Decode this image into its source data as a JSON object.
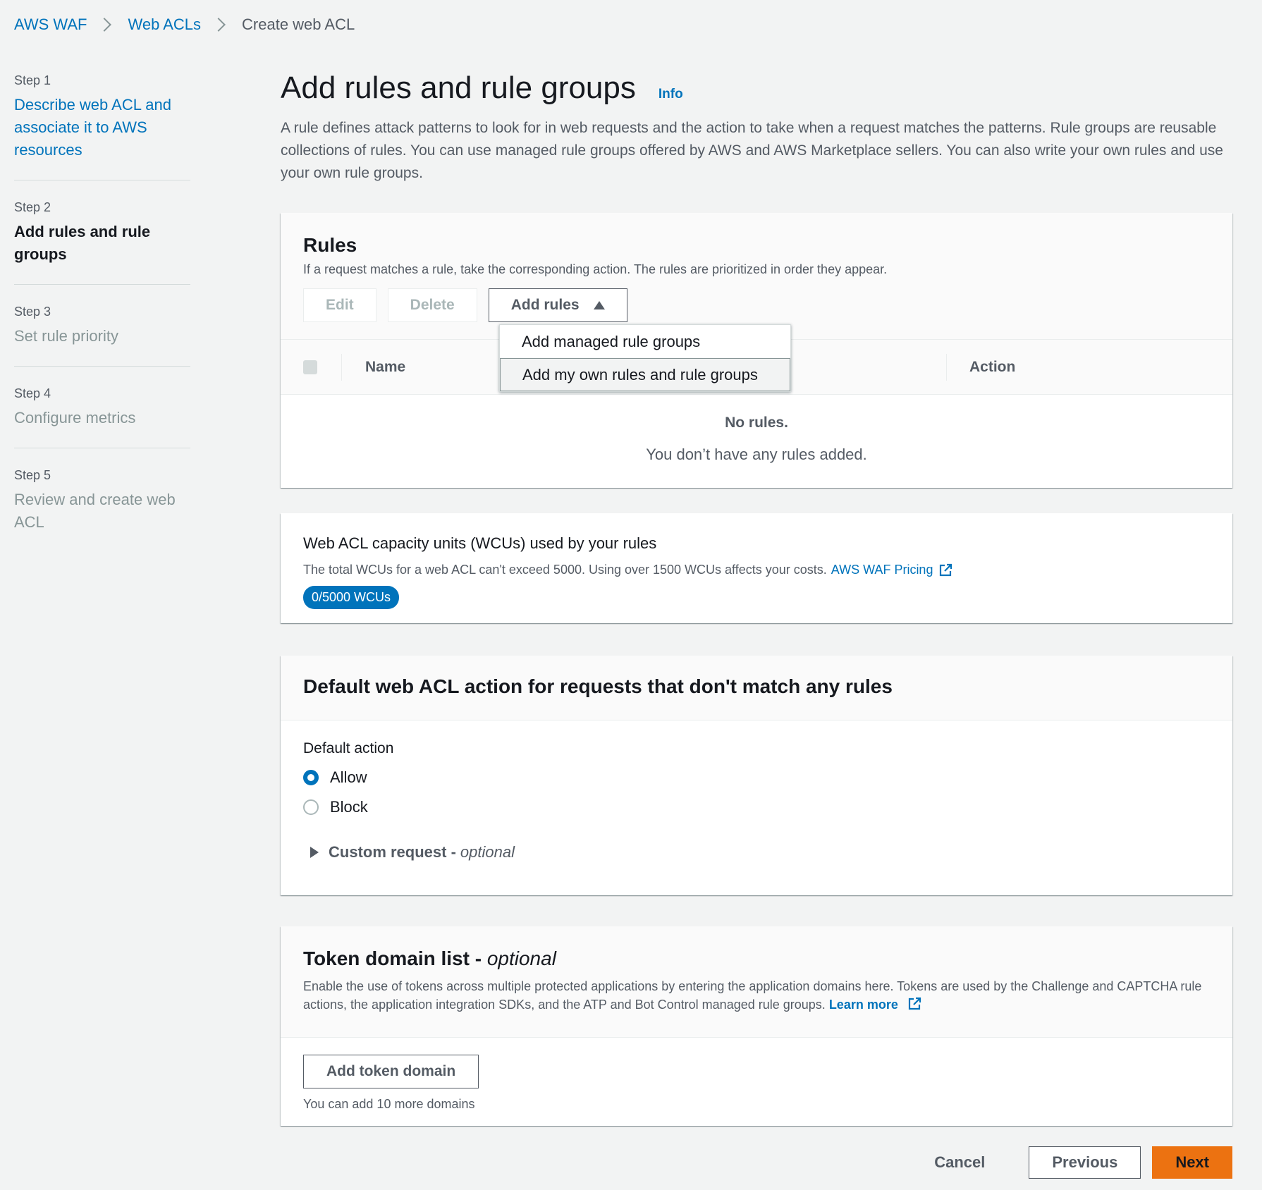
{
  "breadcrumb": {
    "items": [
      "AWS WAF",
      "Web ACLs"
    ],
    "current": "Create web ACL"
  },
  "steps": [
    {
      "num": "Step 1",
      "label": "Describe web ACL and associate it to AWS resources",
      "state": "link"
    },
    {
      "num": "Step 2",
      "label": "Add rules and rule groups",
      "state": "active"
    },
    {
      "num": "Step 3",
      "label": "Set rule priority",
      "state": "disabled"
    },
    {
      "num": "Step 4",
      "label": "Configure metrics",
      "state": "disabled"
    },
    {
      "num": "Step 5",
      "label": "Review and create web ACL",
      "state": "disabled"
    }
  ],
  "page": {
    "title": "Add rules and rule groups",
    "info": "Info",
    "description": "A rule defines attack patterns to look for in web requests and the action to take when a request matches the patterns. Rule groups are reusable collections of rules. You can use managed rule groups offered by AWS and AWS Marketplace sellers. You can also write your own rules and use your own rule groups."
  },
  "rules": {
    "title": "Rules",
    "description": "If a request matches a rule, take the corresponding action. The rules are prioritized in order they appear.",
    "edit": "Edit",
    "delete": "Delete",
    "add_rules": "Add rules",
    "menu": [
      "Add managed rule groups",
      "Add my own rules and rule groups"
    ],
    "columns": {
      "name": "Name",
      "action": "Action"
    },
    "empty_title": "No rules.",
    "empty_desc": "You don’t have any rules added."
  },
  "wcu": {
    "title": "Web ACL capacity units (WCUs) used by your rules",
    "description": "The total WCUs for a web ACL can't exceed 5000. Using over 1500 WCUs affects your costs.",
    "pricing_link": "AWS WAF Pricing",
    "badge": "0/5000 WCUs"
  },
  "default_action": {
    "title": "Default web ACL action for requests that don't match any rules",
    "label": "Default action",
    "options": [
      "Allow",
      "Block"
    ],
    "selected": "Allow",
    "custom_request": "Custom request -",
    "optional": "optional"
  },
  "token": {
    "title": "Token domain list -",
    "optional": "optional",
    "description": "Enable the use of tokens across multiple protected applications by entering the application domains here. Tokens are used by the Challenge and CAPTCHA rule actions, the application integration SDKs, and the ATP and Bot Control managed rule groups.",
    "learn_more": "Learn more",
    "add_button": "Add token domain",
    "hint": "You can add 10 more domains"
  },
  "footer": {
    "cancel": "Cancel",
    "previous": "Previous",
    "next": "Next"
  },
  "colors": {
    "link": "#0073bb",
    "primary": "#ec7211",
    "background": "#f2f3f3"
  }
}
